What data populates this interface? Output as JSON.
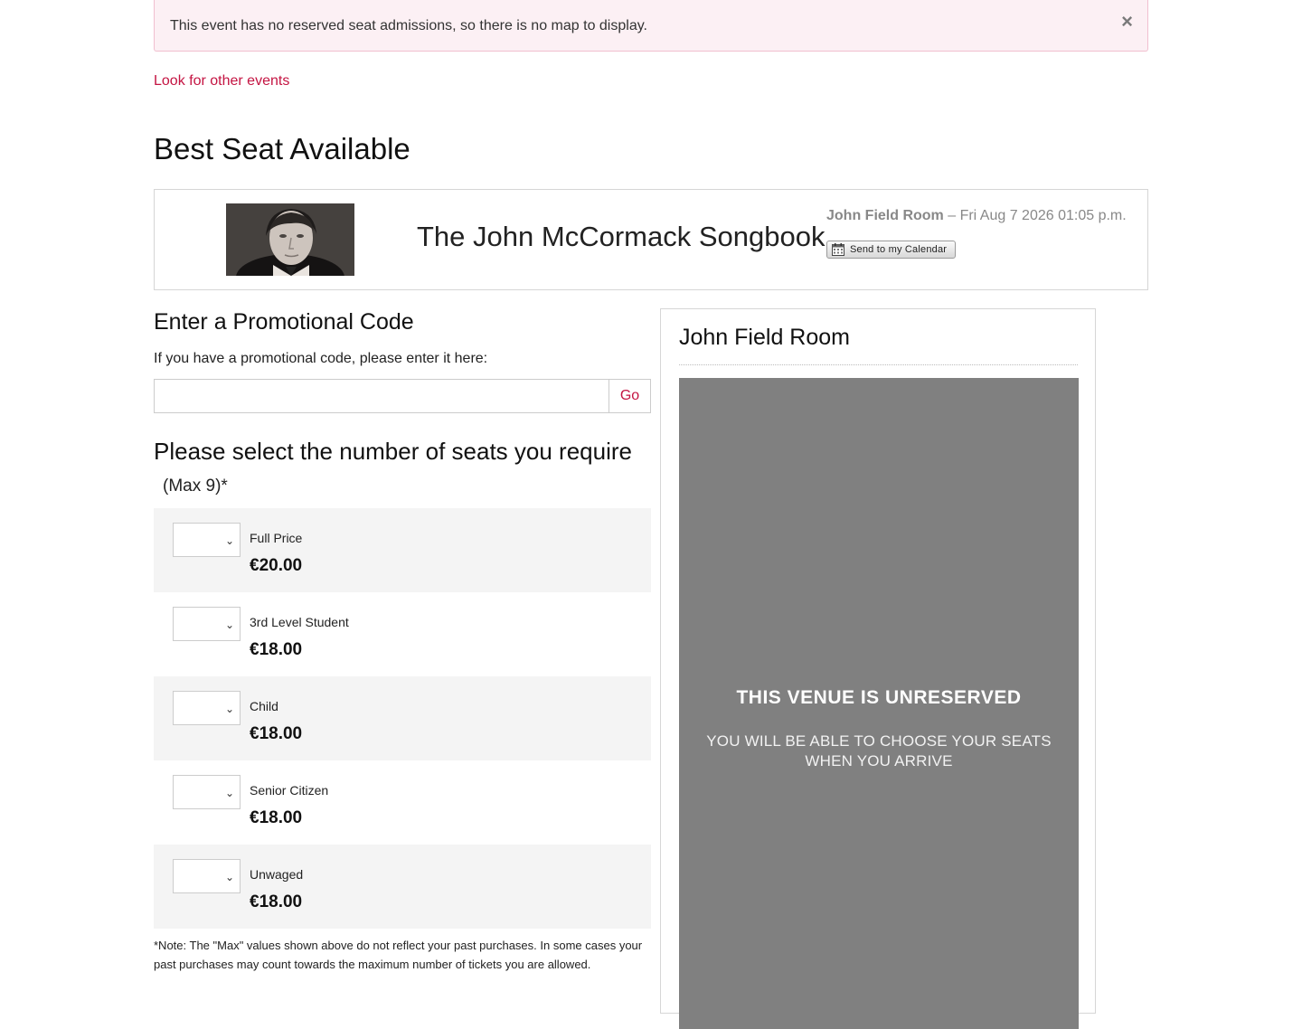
{
  "alert": {
    "message": "This event has no reserved seat admissions, so there is no map to display.",
    "close": "×"
  },
  "links": {
    "other_events": "Look for other events"
  },
  "page_title": "Best Seat Available",
  "event": {
    "name": "The John McCormack Songbook",
    "venue": "John Field Room",
    "datetime": "– Fri Aug 7 2026 01:05 p.m.",
    "calendar_button": "Send to my Calendar"
  },
  "promo": {
    "heading": "Enter a Promotional Code",
    "description": "If you have a promotional code, please enter it here:",
    "input_value": "",
    "go_label": "Go"
  },
  "seats": {
    "heading": "Please select the number of seats you require",
    "max_note": "(Max 9)*",
    "tickets": [
      {
        "type": "Full Price",
        "price": "€20.00"
      },
      {
        "type": "3rd Level Student",
        "price": "€18.00"
      },
      {
        "type": "Child",
        "price": "€18.00"
      },
      {
        "type": "Senior Citizen",
        "price": "€18.00"
      },
      {
        "type": "Unwaged",
        "price": "€18.00"
      }
    ],
    "footnote": "*Note: The \"Max\" values shown above do not reflect your past purchases. In some cases your past purchases may count towards the maximum number of tickets you are allowed."
  },
  "venue_panel": {
    "title": "John Field Room",
    "map_headline": "THIS VENUE IS UNRESERVED",
    "map_sub_line1": "YOU WILL BE ABLE TO CHOOSE YOUR SEATS",
    "map_sub_line2": "WHEN YOU ARRIVE"
  },
  "colors": {
    "accent": "#c41442",
    "alert_bg": "#fcf0f4",
    "row_shade": "#f4f4f4",
    "map_bg": "#808080"
  }
}
